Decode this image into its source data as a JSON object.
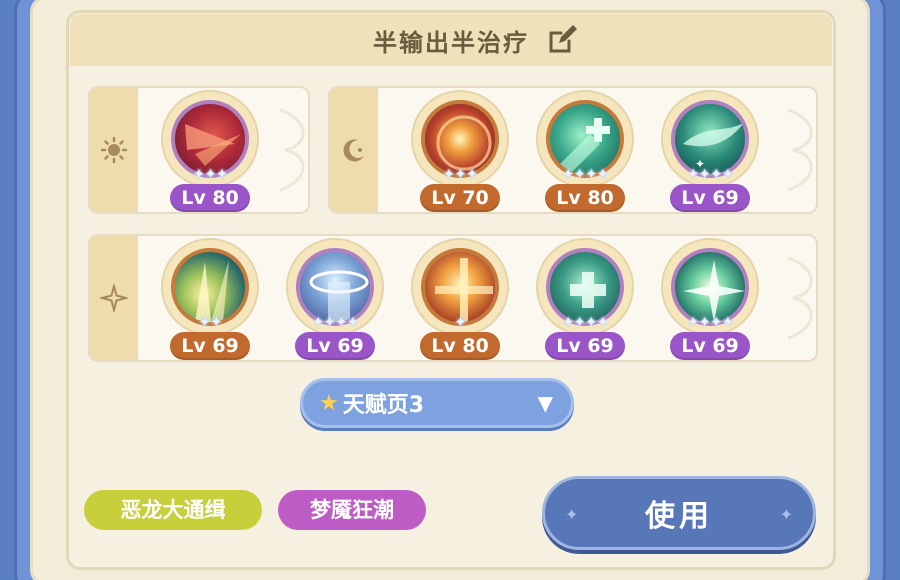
{
  "panel": {
    "title": "半输出半治疗"
  },
  "rows": [
    {
      "icon": "sun-icon",
      "skills": [
        {
          "level": "Lv 80",
          "stars": "✦✦✦",
          "style": "purple",
          "art": "red-slash"
        }
      ]
    },
    {
      "icon": "moon-icon",
      "skills": [
        {
          "level": "Lv 70",
          "stars": "✦✦✦",
          "style": "orange",
          "art": "orange-burst"
        },
        {
          "level": "Lv 80",
          "stars": "✦✦✦✦",
          "style": "orange",
          "art": "green-heal"
        },
        {
          "level": "Lv 69",
          "stars": "✦✦✦✦",
          "style": "purple",
          "art": "green-wind"
        }
      ]
    },
    {
      "icon": "sparkle-icon",
      "skills": [
        {
          "level": "Lv 69",
          "stars": "✦✦",
          "style": "orange",
          "art": "yellow-beam"
        },
        {
          "level": "Lv 69",
          "stars": "✦✦✦✦",
          "style": "purple",
          "art": "blue-halo"
        },
        {
          "level": "Lv 80",
          "stars": "✦",
          "style": "orange",
          "art": "orange-cross"
        },
        {
          "level": "Lv 69",
          "stars": "✦✦✦✦",
          "style": "purple",
          "art": "green-cross"
        },
        {
          "level": "Lv 69",
          "stars": "✦✦✦✦",
          "style": "purple",
          "art": "green-star"
        }
      ]
    }
  ],
  "talent_dropdown": {
    "selected": "天赋页3"
  },
  "tags": [
    "恶龙大通缉",
    "梦魇狂潮"
  ],
  "use_button": "使用",
  "colors": {
    "purple_level": "#9a56c9",
    "orange_level": "#c2692e",
    "button_blue": "#5877b8",
    "tag_yellow": "#c7cf3a",
    "tag_purple": "#be5cc6"
  }
}
